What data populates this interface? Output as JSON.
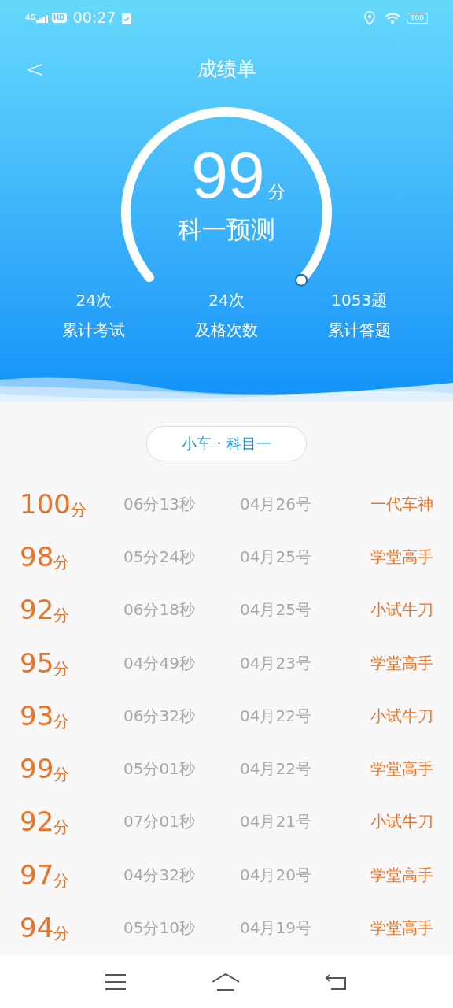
{
  "status_bar": {
    "network": "4G",
    "hd": "HD",
    "time": "00:27",
    "battery": "100"
  },
  "header": {
    "title": "成绩单",
    "back": "<"
  },
  "gauge": {
    "score": "99",
    "unit": "分",
    "label": "科一预测"
  },
  "stats": [
    {
      "value": "24次",
      "label": "累计考试"
    },
    {
      "value": "24次",
      "label": "及格次数"
    },
    {
      "value": "1053题",
      "label": "累计答题"
    }
  ],
  "filter": {
    "label": "小车 · 科目一"
  },
  "records": [
    {
      "score": "100",
      "unit": "分",
      "duration": "06分13秒",
      "date": "04月26号",
      "title": "一代车神"
    },
    {
      "score": "98",
      "unit": "分",
      "duration": "05分24秒",
      "date": "04月25号",
      "title": "学堂高手"
    },
    {
      "score": "92",
      "unit": "分",
      "duration": "06分18秒",
      "date": "04月25号",
      "title": "小试牛刀"
    },
    {
      "score": "95",
      "unit": "分",
      "duration": "04分49秒",
      "date": "04月23号",
      "title": "学堂高手"
    },
    {
      "score": "93",
      "unit": "分",
      "duration": "06分32秒",
      "date": "04月22号",
      "title": "小试牛刀"
    },
    {
      "score": "99",
      "unit": "分",
      "duration": "05分01秒",
      "date": "04月22号",
      "title": "学堂高手"
    },
    {
      "score": "92",
      "unit": "分",
      "duration": "07分01秒",
      "date": "04月21号",
      "title": "小试牛刀"
    },
    {
      "score": "97",
      "unit": "分",
      "duration": "04分32秒",
      "date": "04月20号",
      "title": "学堂高手"
    },
    {
      "score": "94",
      "unit": "分",
      "duration": "05分10秒",
      "date": "04月19号",
      "title": "学堂高手"
    }
  ]
}
